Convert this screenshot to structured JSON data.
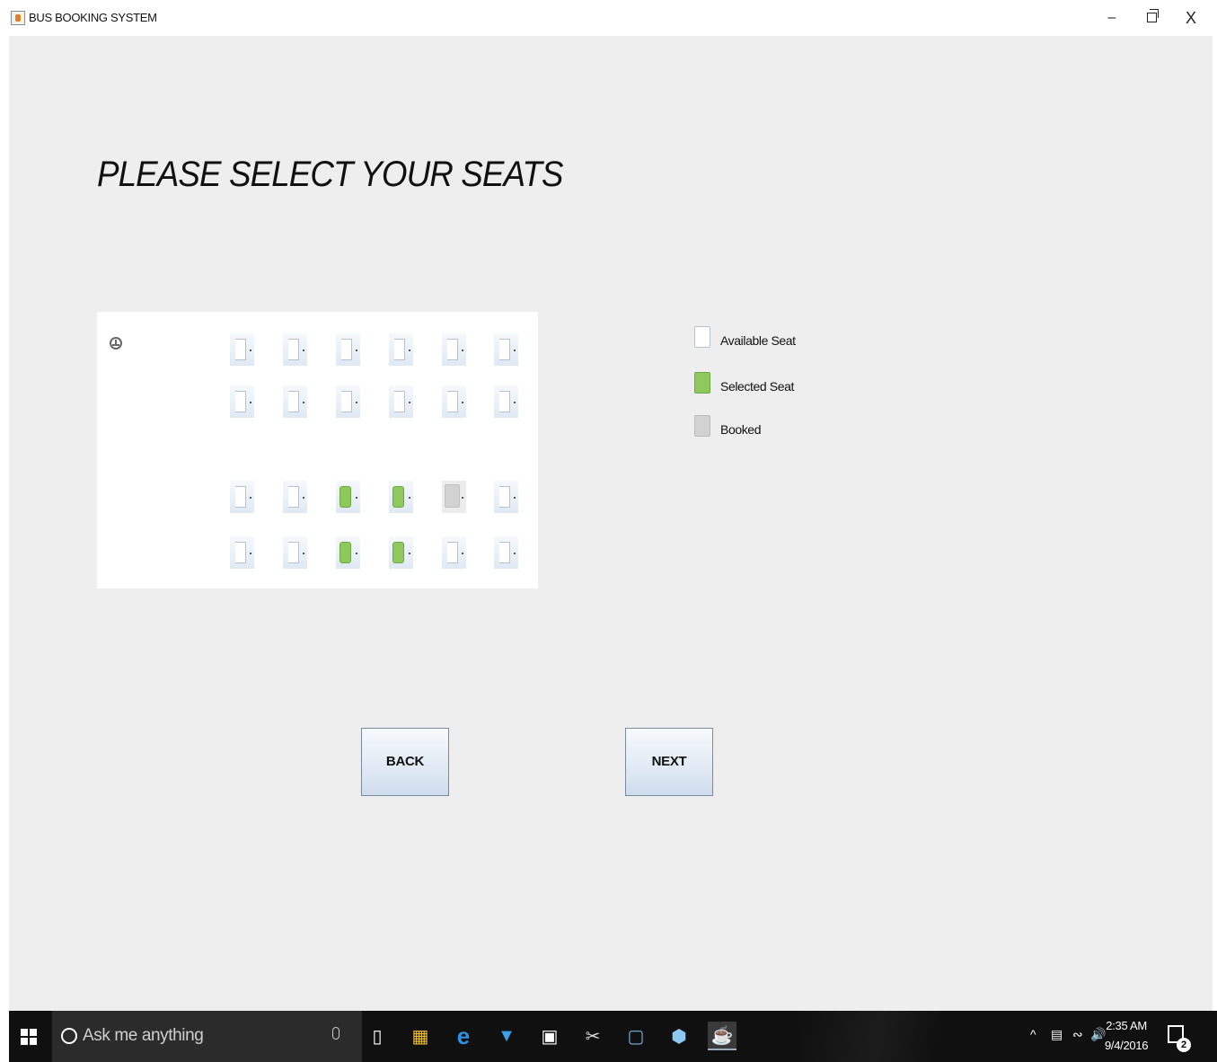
{
  "window": {
    "title": "BUS BOOKING SYSTEM",
    "minimize_label": "–",
    "close_label": "X"
  },
  "page": {
    "heading": "PLEASE SELECT YOUR SEATS"
  },
  "seat_map": {
    "rows": [
      [
        "available",
        "available",
        "available",
        "available",
        "available",
        "available"
      ],
      [
        "available",
        "available",
        "available",
        "available",
        "available",
        "available"
      ],
      [
        "available",
        "available",
        "selected",
        "selected",
        "booked",
        "available"
      ],
      [
        "available",
        "available",
        "selected",
        "selected",
        "available",
        "available"
      ]
    ]
  },
  "legend": {
    "available": "Available Seat",
    "selected": "Selected Seat",
    "booked": "Booked"
  },
  "buttons": {
    "back": "BACK",
    "next": "NEXT"
  },
  "taskbar": {
    "search_placeholder": "Ask me anything",
    "time": "2:35 AM",
    "date": "9/4/2016",
    "notification_count": "2",
    "tray_chevron": "^"
  },
  "colors": {
    "selected_seat": "#8fc95d",
    "booked_seat": "#d2d2d2",
    "background": "#eeeeee"
  }
}
